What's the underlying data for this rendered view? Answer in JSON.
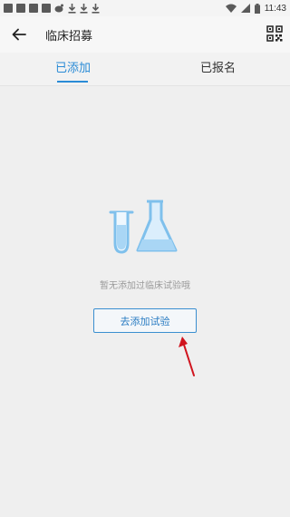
{
  "status_bar": {
    "time": "11:43",
    "icons": [
      "notification-icon",
      "notification-icon",
      "notification-icon",
      "notification-icon",
      "weibo-icon",
      "download-icon",
      "download-icon",
      "download-icon",
      "wifi-icon",
      "signal-icon",
      "battery-icon"
    ]
  },
  "header": {
    "title": "临床招募",
    "back_icon": "back-arrow-icon",
    "action_icon": "qr-code-icon"
  },
  "tabs": [
    {
      "label": "已添加",
      "active": true
    },
    {
      "label": "已报名",
      "active": false
    }
  ],
  "empty_state": {
    "icon": "lab-flask-icon",
    "message": "暂无添加过临床试验哦",
    "button_label": "去添加试验"
  },
  "colors": {
    "accent": "#2a8bd6",
    "background": "#efefef",
    "annotation_arrow": "#d0141e"
  }
}
